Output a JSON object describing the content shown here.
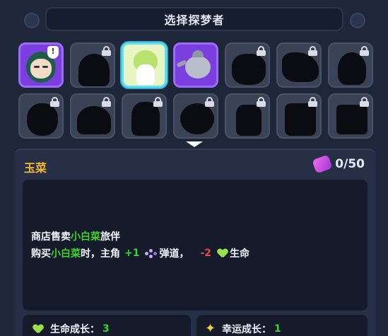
{
  "header": {
    "title": "选择探梦者"
  },
  "characters": [
    {
      "id": "girl",
      "state": "unlocked",
      "badge": "!"
    },
    {
      "id": "locked-1",
      "state": "locked"
    },
    {
      "id": "cabbage",
      "state": "selected"
    },
    {
      "id": "teapot",
      "state": "unlocked"
    },
    {
      "id": "locked-2",
      "state": "locked"
    },
    {
      "id": "locked-3",
      "state": "locked"
    },
    {
      "id": "locked-4",
      "state": "locked"
    },
    {
      "id": "locked-5",
      "state": "locked"
    },
    {
      "id": "locked-6",
      "state": "locked"
    },
    {
      "id": "locked-7",
      "state": "locked"
    },
    {
      "id": "locked-8",
      "state": "locked"
    },
    {
      "id": "locked-9",
      "state": "locked"
    },
    {
      "id": "locked-10",
      "state": "locked"
    },
    {
      "id": "locked-11",
      "state": "locked"
    }
  ],
  "detail": {
    "name": "玉菜",
    "gems": "0/50",
    "line1": {
      "a": "商店售卖",
      "b": "小白菜",
      "c": "旅伴"
    },
    "line2": {
      "a": "购买",
      "b": "小白菜",
      "c": "时，主角",
      "plus": "+1",
      "d": "弹道，",
      "minus": "-2",
      "e": "生命"
    },
    "stats": [
      {
        "label": "生命成长：",
        "value": "3",
        "icon": "heart-icon"
      },
      {
        "label": "幸运成长：",
        "value": "1",
        "icon": "sparkle-icon"
      }
    ]
  },
  "colors": {
    "accent_gold": "#f4b731",
    "accent_green": "#3fd12f",
    "accent_red": "#e84646",
    "purple": "#7b3fe0",
    "cyan": "#62e0f0"
  }
}
